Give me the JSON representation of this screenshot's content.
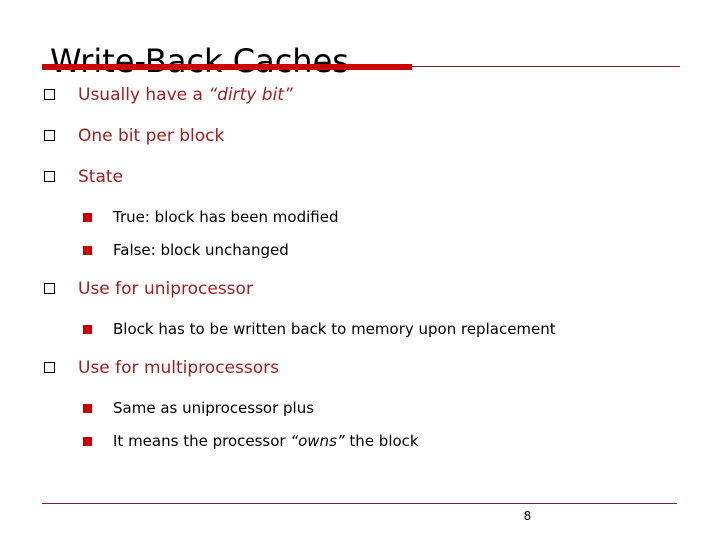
{
  "slide": {
    "title": "Write-Back Caches",
    "page_number": "8",
    "colors": {
      "title_text": "#000000",
      "level1_text": "#a02020",
      "level2_text": "#000000",
      "accent_bar": "#cc0000",
      "rule_line": "#7a2028",
      "level1_marker_outline": "#000000",
      "level2_marker_fill": "#cc0000",
      "background": "#ffffff"
    },
    "bullets": [
      {
        "level": 1,
        "marker": "hollow-square-bullet",
        "text_parts": [
          {
            "text": "Usually have a ",
            "style": "normal"
          },
          {
            "text": "“dirty bit”",
            "style": "italic"
          }
        ],
        "plain_text": "Usually have a “dirty bit”"
      },
      {
        "level": 1,
        "marker": "hollow-square-bullet",
        "text_parts": [
          {
            "text": "One bit per block",
            "style": "normal"
          }
        ],
        "plain_text": "One bit per block"
      },
      {
        "level": 1,
        "marker": "hollow-square-bullet",
        "text_parts": [
          {
            "text": "State",
            "style": "normal"
          }
        ],
        "plain_text": "State"
      },
      {
        "level": 2,
        "marker": "filled-square-bullet",
        "text_parts": [
          {
            "text": "True: block has been modified",
            "style": "normal"
          }
        ],
        "plain_text": "True: block has been modified"
      },
      {
        "level": 2,
        "marker": "filled-square-bullet",
        "text_parts": [
          {
            "text": "False: block unchanged",
            "style": "normal"
          }
        ],
        "plain_text": "False: block unchanged"
      },
      {
        "level": 1,
        "marker": "hollow-square-bullet",
        "text_parts": [
          {
            "text": "Use for uniprocessor",
            "style": "normal"
          }
        ],
        "plain_text": "Use for uniprocessor"
      },
      {
        "level": 2,
        "marker": "filled-square-bullet",
        "text_parts": [
          {
            "text": "Block has to be written back to memory upon replacement",
            "style": "normal"
          }
        ],
        "plain_text": "Block has to be written back to memory upon replacement"
      },
      {
        "level": 1,
        "marker": "hollow-square-bullet",
        "text_parts": [
          {
            "text": "Use for multiprocessors",
            "style": "normal"
          }
        ],
        "plain_text": "Use for multiprocessors"
      },
      {
        "level": 2,
        "marker": "filled-square-bullet",
        "text_parts": [
          {
            "text": "Same as uniprocessor plus",
            "style": "normal"
          }
        ],
        "plain_text": "Same as uniprocessor plus"
      },
      {
        "level": 2,
        "marker": "filled-square-bullet",
        "text_parts": [
          {
            "text": "It means the processor ",
            "style": "normal"
          },
          {
            "text": "“owns”",
            "style": "italic"
          },
          {
            "text": " the block",
            "style": "normal"
          }
        ],
        "plain_text": "It means the processor “owns” the block"
      }
    ]
  }
}
